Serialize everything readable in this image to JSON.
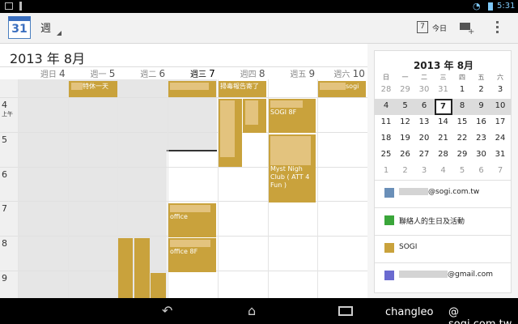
{
  "status": {
    "time": "5:31"
  },
  "actionbar": {
    "view_label": "週",
    "today_label": "今日",
    "today_num": "7",
    "app_icon_num": "31"
  },
  "header": {
    "month_title": "2013 年 8月"
  },
  "days": [
    {
      "name": "週日",
      "num": "4"
    },
    {
      "name": "週一",
      "num": "5"
    },
    {
      "name": "週二",
      "num": "6"
    },
    {
      "name": "週三",
      "num": "7"
    },
    {
      "name": "週四",
      "num": "8"
    },
    {
      "name": "週五",
      "num": "9"
    },
    {
      "name": "週六",
      "num": "10"
    }
  ],
  "hours": [
    {
      "h": "4",
      "sub": "上午"
    },
    {
      "h": "5",
      "sub": ""
    },
    {
      "h": "6",
      "sub": ""
    },
    {
      "h": "7",
      "sub": ""
    },
    {
      "h": "8",
      "sub": ""
    },
    {
      "h": "9",
      "sub": ""
    }
  ],
  "events": {
    "allday_mon": "特休一天",
    "allday_thu": "掃毒報告寄了",
    "allday_sat": "sogi",
    "fri_sogi": "SOGI 8F",
    "fri_club": "Myst Nigh Club ( ATT 4 Fun )",
    "wed_office": "office",
    "wed_office8f": "office 8F"
  },
  "mini_cal": {
    "title": "2013 年 8月",
    "weekdays": [
      "日",
      "一",
      "二",
      "三",
      "四",
      "五",
      "六"
    ],
    "weeks": [
      [
        "28",
        "29",
        "30",
        "31",
        "1",
        "2",
        "3"
      ],
      [
        "4",
        "5",
        "6",
        "7",
        "8",
        "9",
        "10"
      ],
      [
        "11",
        "12",
        "13",
        "14",
        "15",
        "16",
        "17"
      ],
      [
        "18",
        "19",
        "20",
        "21",
        "22",
        "23",
        "24"
      ],
      [
        "25",
        "26",
        "27",
        "28",
        "29",
        "30",
        "31"
      ],
      [
        "1",
        "2",
        "3",
        "4",
        "5",
        "6",
        "7"
      ]
    ],
    "selected": "7"
  },
  "calendars": [
    {
      "label": "@sogi.com.tw",
      "color": "#6a8fb8"
    },
    {
      "label": "聯絡人的生日及活動",
      "color": "#3aa63a"
    },
    {
      "label": "SOGI",
      "color": "#c9a23c"
    },
    {
      "label": "@gmail.com",
      "color": "#6a6ad0"
    }
  ],
  "watermark": {
    "user": "changleo",
    "site": "@ sogi.com.tw"
  }
}
